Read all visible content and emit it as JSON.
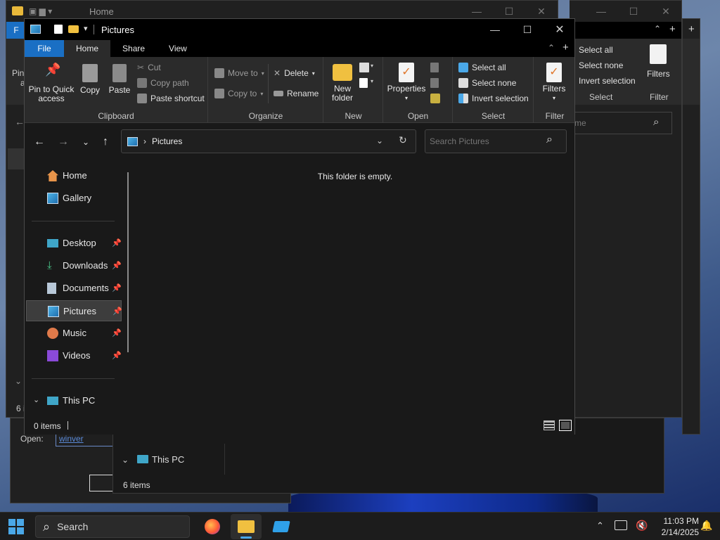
{
  "home_window": {
    "title": "Home",
    "tab_file": "F",
    "nav_partial": "Pin",
    "nav_partial2": "a",
    "status_partial": "6 i"
  },
  "back_window2": {
    "select_all": "Select all",
    "select_none": "Select none",
    "invert_selection": "Invert selection",
    "select_group": "Select",
    "filters": "Filters",
    "filter_group": "Filter",
    "search_partial": "me"
  },
  "run_dialog": {
    "open_label": "Open:",
    "open_value": "winver"
  },
  "pc_window": {
    "this_pc": "This PC",
    "status": "6 items"
  },
  "main_window": {
    "title": "Pictures",
    "tabs": [
      "File",
      "Home",
      "Share",
      "View"
    ],
    "ribbon": {
      "clipboard": {
        "pin_label": "Pin to Quick access",
        "copy": "Copy",
        "paste": "Paste",
        "cut": "Cut",
        "copy_path": "Copy path",
        "paste_shortcut": "Paste shortcut",
        "group": "Clipboard"
      },
      "organize": {
        "move_to": "Move to",
        "copy_to": "Copy to",
        "delete": "Delete",
        "rename": "Rename",
        "group": "Organize"
      },
      "new": {
        "new_folder": "New folder",
        "group": "New"
      },
      "open": {
        "properties": "Properties",
        "group": "Open"
      },
      "select": {
        "select_all": "Select all",
        "select_none": "Select none",
        "invert_selection": "Invert selection",
        "group": "Select"
      },
      "filter": {
        "filters": "Filters",
        "group": "Filter"
      }
    },
    "address": {
      "path": "Pictures",
      "search_placeholder": "Search Pictures"
    },
    "nav": {
      "home": "Home",
      "gallery": "Gallery",
      "desktop": "Desktop",
      "downloads": "Downloads",
      "documents": "Documents",
      "pictures": "Pictures",
      "music": "Music",
      "videos": "Videos",
      "this_pc": "This PC"
    },
    "empty_message": "This folder is empty.",
    "status": "0 items"
  },
  "taskbar": {
    "search_label": "Search",
    "time": "11:03 PM",
    "date": "2/14/2025"
  },
  "colors": {
    "accent_blue": "#1a6fc4",
    "window_bg": "#191919",
    "ribbon_bg": "#2b2b2b"
  }
}
